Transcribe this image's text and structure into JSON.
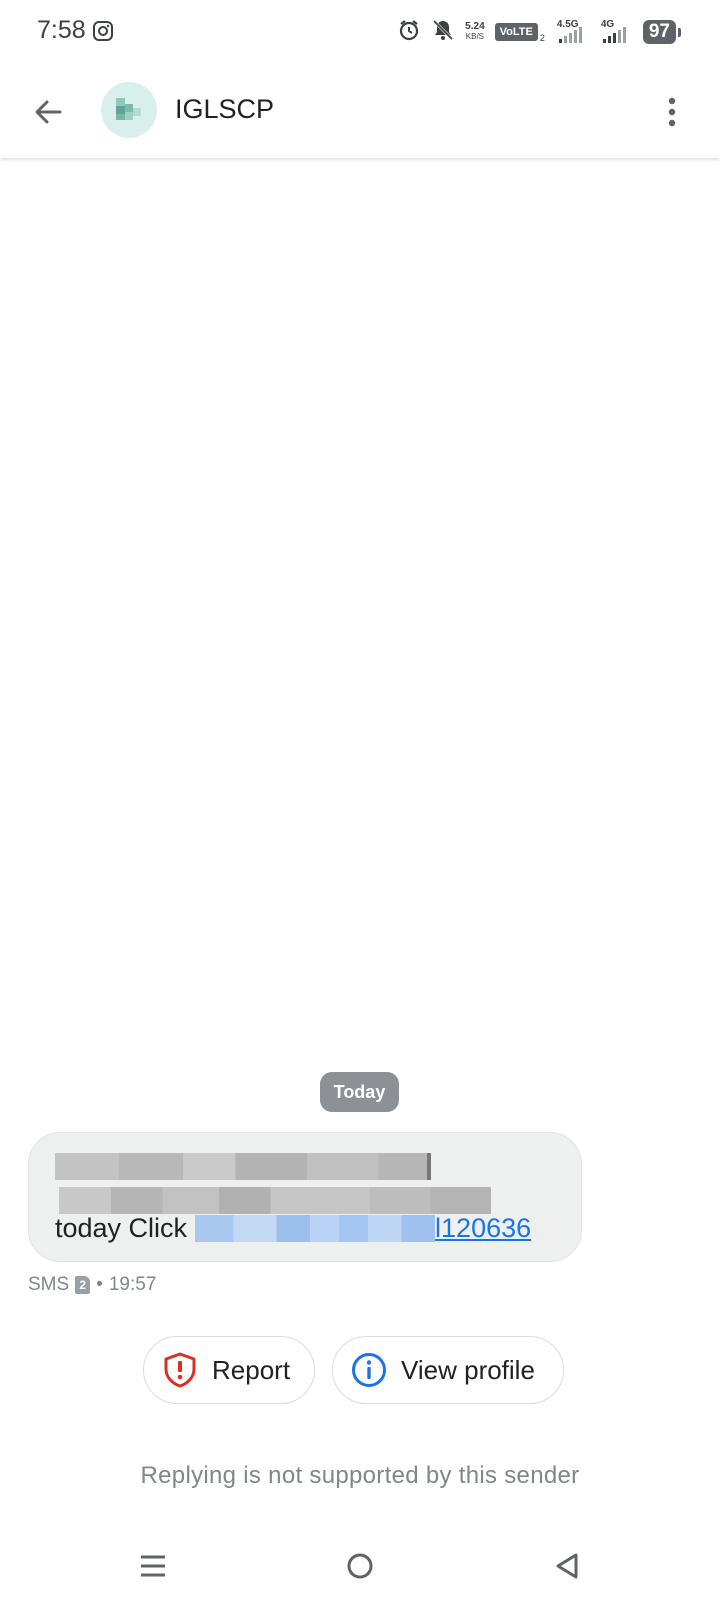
{
  "status_bar": {
    "time": "7:58",
    "net_speed_value": "5.24",
    "net_speed_unit": "KB/S",
    "volte": "VoLTE",
    "volte_sim": "2",
    "net1": "4.5G",
    "net2": "4G",
    "battery": "97"
  },
  "header": {
    "title": "IGLSCP"
  },
  "conversation": {
    "date_chip": "Today",
    "message": {
      "text_prefix": "today Click",
      "link_suffix": "l120636"
    },
    "meta": {
      "type": "SMS",
      "sim": "2",
      "separator": "•",
      "time": "19:57"
    }
  },
  "actions": {
    "report_label": "Report",
    "view_profile_label": "View profile"
  },
  "footer": {
    "reply_note": "Replying is not supported by this sender"
  },
  "colors": {
    "link": "#1a73e8",
    "report_icon": "#d93025",
    "info_icon": "#1a73e8",
    "date_chip_bg": "#8d9196",
    "bubble_bg": "#eeefef"
  },
  "icons": {
    "back": "arrow-left-icon",
    "avatar": "contact-avatar-icon",
    "overflow": "more-vert-icon",
    "report": "shield-alert-icon",
    "view_profile": "info-icon",
    "nav_recents": "menu-lines-icon",
    "nav_home": "circle-home-icon",
    "nav_back": "triangle-back-icon"
  }
}
